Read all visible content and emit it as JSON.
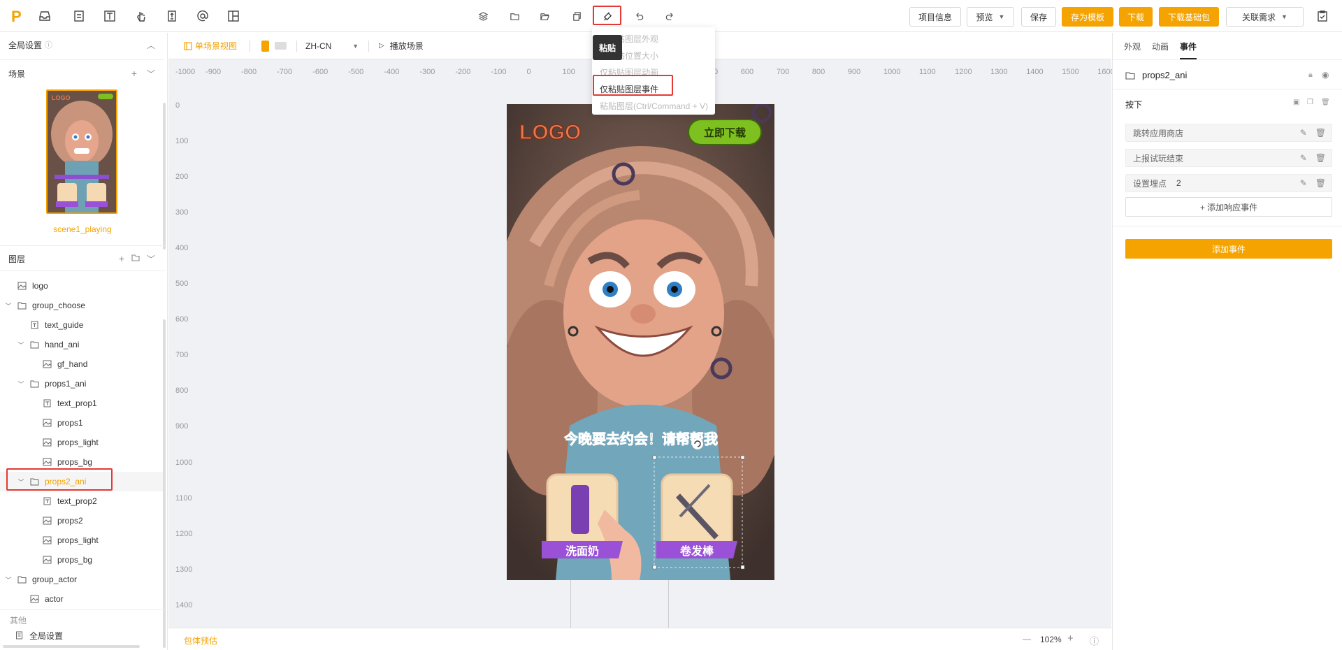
{
  "topbar": {
    "logo": "P",
    "buttons": {
      "project_info": "项目信息",
      "preview": "预览",
      "save": "保存",
      "save_template": "存为模板",
      "download": "下载",
      "download_base": "下载基础包",
      "related_req": "关联需求"
    }
  },
  "left": {
    "global_settings": "全局设置",
    "scenes_title": "场景",
    "scene_name": "scene1_playing",
    "layers_title": "图层",
    "layers": [
      {
        "label": "logo",
        "icon": "image-icon",
        "indent": 0,
        "chev": false
      },
      {
        "label": "group_choose",
        "icon": "folder-icon",
        "indent": 0,
        "chev": true
      },
      {
        "label": "text_guide",
        "icon": "text-icon",
        "indent": 1,
        "chev": false
      },
      {
        "label": "hand_ani",
        "icon": "folder-icon",
        "indent": 1,
        "chev": true
      },
      {
        "label": "gf_hand",
        "icon": "image-icon",
        "indent": 2,
        "chev": false
      },
      {
        "label": "props1_ani",
        "icon": "folder-icon",
        "indent": 1,
        "chev": true
      },
      {
        "label": "text_prop1",
        "icon": "text-icon",
        "indent": 2,
        "chev": false
      },
      {
        "label": "props1",
        "icon": "image-icon",
        "indent": 2,
        "chev": false
      },
      {
        "label": "props_light",
        "icon": "image-icon",
        "indent": 2,
        "chev": false
      },
      {
        "label": "props_bg",
        "icon": "image-icon",
        "indent": 2,
        "chev": false
      },
      {
        "label": "props2_ani",
        "icon": "folder-icon",
        "indent": 1,
        "chev": true,
        "selected": true
      },
      {
        "label": "text_prop2",
        "icon": "text-icon",
        "indent": 2,
        "chev": false
      },
      {
        "label": "props2",
        "icon": "image-icon",
        "indent": 2,
        "chev": false
      },
      {
        "label": "props_light",
        "icon": "image-icon",
        "indent": 2,
        "chev": false
      },
      {
        "label": "props_bg",
        "icon": "image-icon",
        "indent": 2,
        "chev": false
      },
      {
        "label": "group_actor",
        "icon": "folder-icon",
        "indent": 0,
        "chev": true
      },
      {
        "label": "actor",
        "icon": "image-icon",
        "indent": 1,
        "chev": false
      }
    ],
    "other_title": "其他",
    "other_item": "全局设置"
  },
  "canvas": {
    "view_label": "单场景视图",
    "lang": "ZH-CN",
    "play_label": "播放场景",
    "ruler_x": [
      "-1000",
      "-900",
      "-800",
      "-700",
      "-600",
      "-500",
      "-400",
      "-300",
      "-200",
      "-100",
      "0",
      "100",
      "200",
      "300",
      "400",
      "500",
      "600",
      "700",
      "800",
      "900",
      "1000",
      "1100",
      "1200",
      "1300",
      "1400",
      "1500",
      "1600"
    ],
    "ruler_y": [
      "0",
      "100",
      "200",
      "300",
      "400",
      "500",
      "600",
      "700",
      "800",
      "900",
      "1000",
      "1100",
      "1200",
      "1300",
      "1400"
    ],
    "package_estimate": "包体预估",
    "zoom": "102%",
    "ad": {
      "logo": "LOGO",
      "download_btn": "立即下载",
      "banner": "今晚要去约会！请帮帮我",
      "prop1": "洗面奶",
      "prop2": "卷发棒"
    }
  },
  "paste_menu": {
    "tooltip": "粘贴",
    "items": [
      {
        "label": "仅粘贴图层外观",
        "enabled": false
      },
      {
        "label": "仅粘贴位置大小",
        "enabled": false
      },
      {
        "label": "仅粘贴图层动画",
        "enabled": false
      },
      {
        "label": "仅粘贴图层事件",
        "enabled": true
      },
      {
        "label": "粘贴图层(Ctrl/Command + V)",
        "enabled": false
      }
    ]
  },
  "right": {
    "tabs": [
      "外观",
      "动画",
      "事件"
    ],
    "active_tab": "事件",
    "layer_name": "props2_ani",
    "trigger": "按下",
    "events": [
      {
        "label": "跳转应用商店",
        "value": ""
      },
      {
        "label": "上报试玩结束",
        "value": ""
      },
      {
        "label": "设置埋点",
        "value": "2"
      }
    ],
    "add_response": "+ 添加响应事件",
    "add_event": "添加事件"
  },
  "colors": {
    "accent": "#f5a300",
    "highlight": "#e53935"
  }
}
